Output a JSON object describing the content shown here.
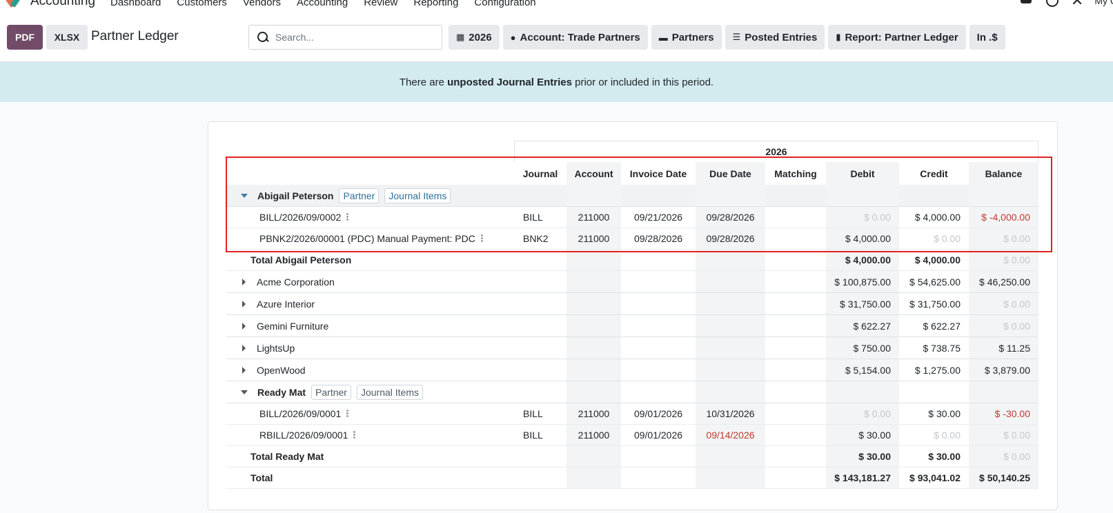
{
  "nav": {
    "app_name": "Accounting",
    "menu": [
      "Dashboard",
      "Customers",
      "Vendors",
      "Accounting",
      "Review",
      "Reporting",
      "Configuration"
    ],
    "user_label": "My C"
  },
  "control": {
    "pdf_label": "PDF",
    "xlsx_label": "XLSX",
    "title": "Partner Ledger",
    "search_placeholder": "Search...",
    "filters": [
      {
        "icon": "calendar-icon",
        "label": "2026"
      },
      {
        "icon": "user-icon",
        "label": "Account: Trade Partners"
      },
      {
        "icon": "folder-icon",
        "label": "Partners"
      },
      {
        "icon": "sliders-icon",
        "label": "Posted Entries"
      },
      {
        "icon": "book-icon",
        "label": "Report: Partner Ledger"
      },
      {
        "icon": "",
        "label": "In .$"
      }
    ]
  },
  "banner": {
    "before": "There are ",
    "bold": "unposted Journal Entries",
    "after": " prior or included in this period."
  },
  "report": {
    "period": "2026",
    "columns": [
      "Journal",
      "Account",
      "Invoice Date",
      "Due Date",
      "Matching",
      "Debit",
      "Credit",
      "Balance"
    ],
    "tag_partner": "Partner",
    "tag_journal_items": "Journal Items",
    "partners": [
      {
        "name": "Abigail Peterson",
        "expanded": true,
        "lines": [
          {
            "ref": "BILL/2026/09/0002",
            "journal": "BILL",
            "account": "211000",
            "invoice_date": "09/21/2026",
            "due_date": "09/28/2026",
            "matching": "",
            "debit": "$ 0.00",
            "credit": "$ 4,000.00",
            "balance": "$ -4,000.00"
          },
          {
            "ref": "PBNK2/2026/00001 (PDC) Manual Payment: PDC",
            "journal": "BNK2",
            "account": "211000",
            "invoice_date": "09/28/2026",
            "due_date": "09/28/2026",
            "matching": "",
            "debit": "$ 4,000.00",
            "credit": "$ 0.00",
            "balance": "$ 0.00"
          }
        ],
        "total_label": "Total Abigail Peterson",
        "total": {
          "debit": "$ 4,000.00",
          "credit": "$ 4,000.00",
          "balance": "$ 0.00"
        }
      },
      {
        "name": "Acme Corporation",
        "expanded": false,
        "debit": "$ 100,875.00",
        "credit": "$ 54,625.00",
        "balance": "$ 46,250.00"
      },
      {
        "name": "Azure Interior",
        "expanded": false,
        "debit": "$ 31,750.00",
        "credit": "$ 31,750.00",
        "balance": "$ 0.00"
      },
      {
        "name": "Gemini Furniture",
        "expanded": false,
        "debit": "$ 622.27",
        "credit": "$ 622.27",
        "balance": "$ 0.00"
      },
      {
        "name": "LightsUp",
        "expanded": false,
        "debit": "$ 750.00",
        "credit": "$ 738.75",
        "balance": "$ 11.25"
      },
      {
        "name": "OpenWood",
        "expanded": false,
        "debit": "$ 5,154.00",
        "credit": "$ 1,275.00",
        "balance": "$ 3,879.00"
      },
      {
        "name": "Ready Mat",
        "expanded": true,
        "lines": [
          {
            "ref": "BILL/2026/09/0001",
            "journal": "BILL",
            "account": "211000",
            "invoice_date": "09/01/2026",
            "due_date": "10/31/2026",
            "matching": "",
            "debit": "$ 0.00",
            "credit": "$ 30.00",
            "balance": "$ -30.00"
          },
          {
            "ref": "RBILL/2026/09/0001",
            "journal": "BILL",
            "account": "211000",
            "invoice_date": "09/01/2026",
            "due_date": "09/14/2026",
            "matching": "",
            "debit": "$ 30.00",
            "credit": "$ 0.00",
            "balance": "$ 0.00"
          }
        ],
        "total_label": "Total Ready Mat",
        "total": {
          "debit": "$ 30.00",
          "credit": "$ 30.00",
          "balance": "$ 0.00"
        }
      }
    ],
    "grand_total_label": "Total",
    "grand_total": {
      "debit": "$ 143,181.27",
      "credit": "$ 93,041.02",
      "balance": "$ 50,140.25"
    }
  },
  "colors": {
    "brand": "#714b67",
    "banner": "#d3ebef",
    "negative": "#c0392b",
    "highlight": "#e02020"
  }
}
